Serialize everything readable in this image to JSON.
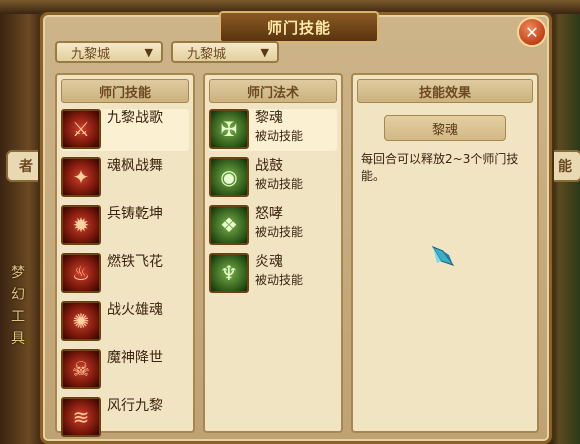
{
  "window": {
    "title": "师门技能",
    "close_symbol": "✕"
  },
  "dropdowns": [
    {
      "value": "九黎城"
    },
    {
      "value": "九黎城"
    }
  ],
  "panels": {
    "school_skills": {
      "header": "师门技能",
      "items": [
        {
          "name": "九黎战歌",
          "icon": "war-song-icon"
        },
        {
          "name": "魂枫战舞",
          "icon": "maple-dance-icon"
        },
        {
          "name": "兵铸乾坤",
          "icon": "forge-icon"
        },
        {
          "name": "燃铁飞花",
          "icon": "flame-iron-icon"
        },
        {
          "name": "战火雄魂",
          "icon": "warfire-icon"
        },
        {
          "name": "魔神降世",
          "icon": "demon-god-icon"
        },
        {
          "name": "风行九黎",
          "icon": "wind-icon"
        }
      ]
    },
    "school_spells": {
      "header": "师门法术",
      "items": [
        {
          "name": "黎魂",
          "type": "被动技能",
          "icon": "soul-icon"
        },
        {
          "name": "战鼓",
          "type": "被动技能",
          "icon": "war-drum-icon"
        },
        {
          "name": "怒哮",
          "type": "被动技能",
          "icon": "roar-icon"
        },
        {
          "name": "炎魂",
          "type": "被动技能",
          "icon": "flame-soul-icon"
        }
      ]
    },
    "skill_effect": {
      "header": "技能效果",
      "selected_name": "黎魂",
      "description": "每回合可以释放2~3个师门技能。"
    }
  },
  "background": {
    "left_vertical_text": [
      "梦",
      "幻",
      "工",
      "具"
    ],
    "left_tab_partial": "者",
    "right_tab_partial": "能"
  }
}
